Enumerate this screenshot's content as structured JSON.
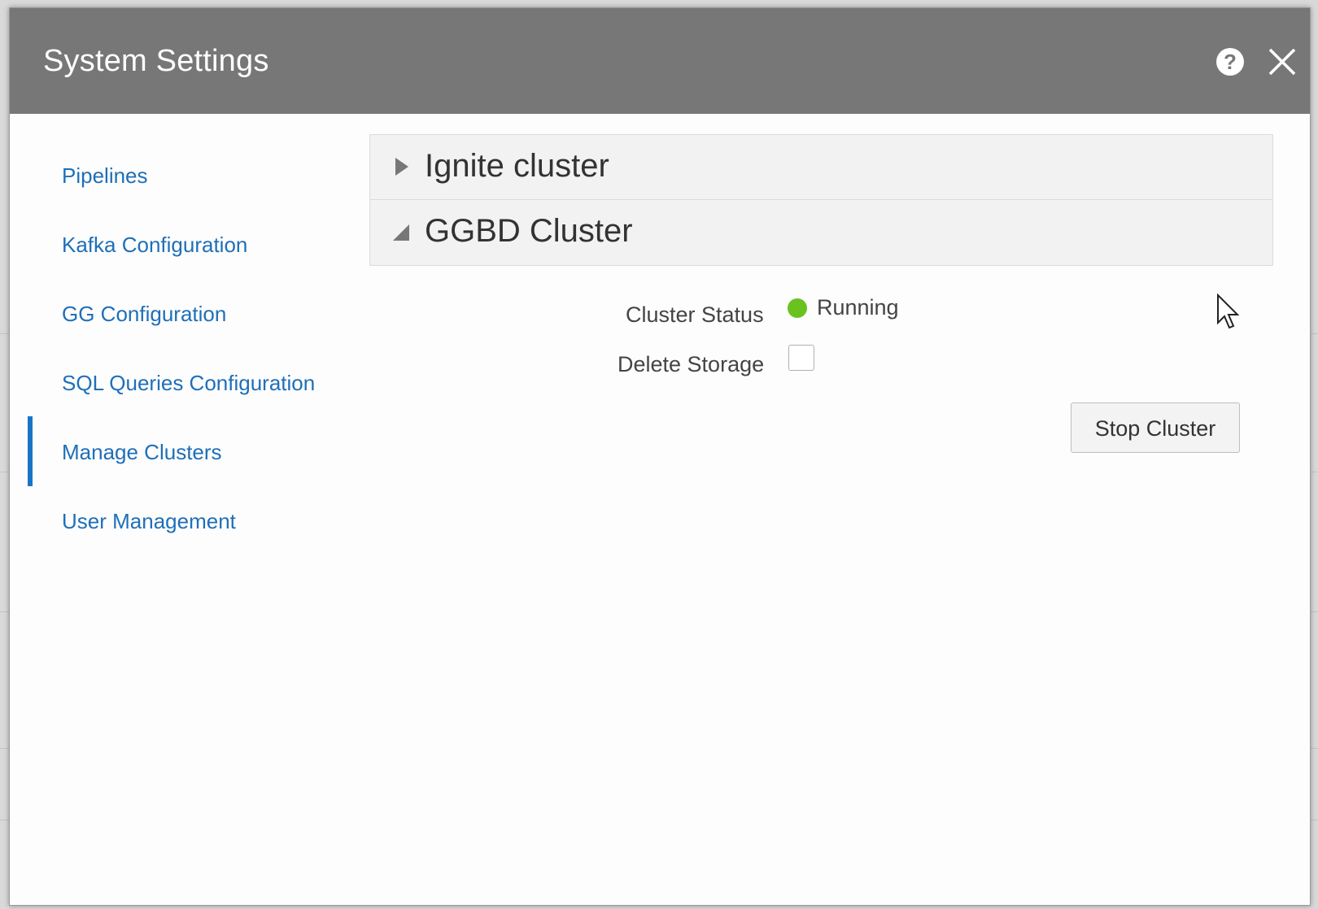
{
  "dialog": {
    "title": "System Settings",
    "help_icon": "help-icon",
    "close_icon": "close-icon"
  },
  "nav": {
    "active_index": 4,
    "items": [
      {
        "label": "Pipelines"
      },
      {
        "label": "Kafka Configuration"
      },
      {
        "label": "GG Configuration"
      },
      {
        "label": "SQL Queries Configuration"
      },
      {
        "label": "Manage Clusters"
      },
      {
        "label": "User Management"
      }
    ]
  },
  "accordion": [
    {
      "title": "Ignite cluster",
      "expanded": false
    },
    {
      "title": "GGBD Cluster",
      "expanded": true
    }
  ],
  "cluster": {
    "status_label": "Cluster Status",
    "status_value": "Running",
    "status_color": "#6ac220",
    "delete_storage_label": "Delete Storage",
    "delete_storage_checked": false,
    "stop_button_label": "Stop Cluster"
  },
  "colors": {
    "titlebar": "#777777",
    "nav_link": "#1f6fb8",
    "active_indicator": "#1a74c6"
  }
}
